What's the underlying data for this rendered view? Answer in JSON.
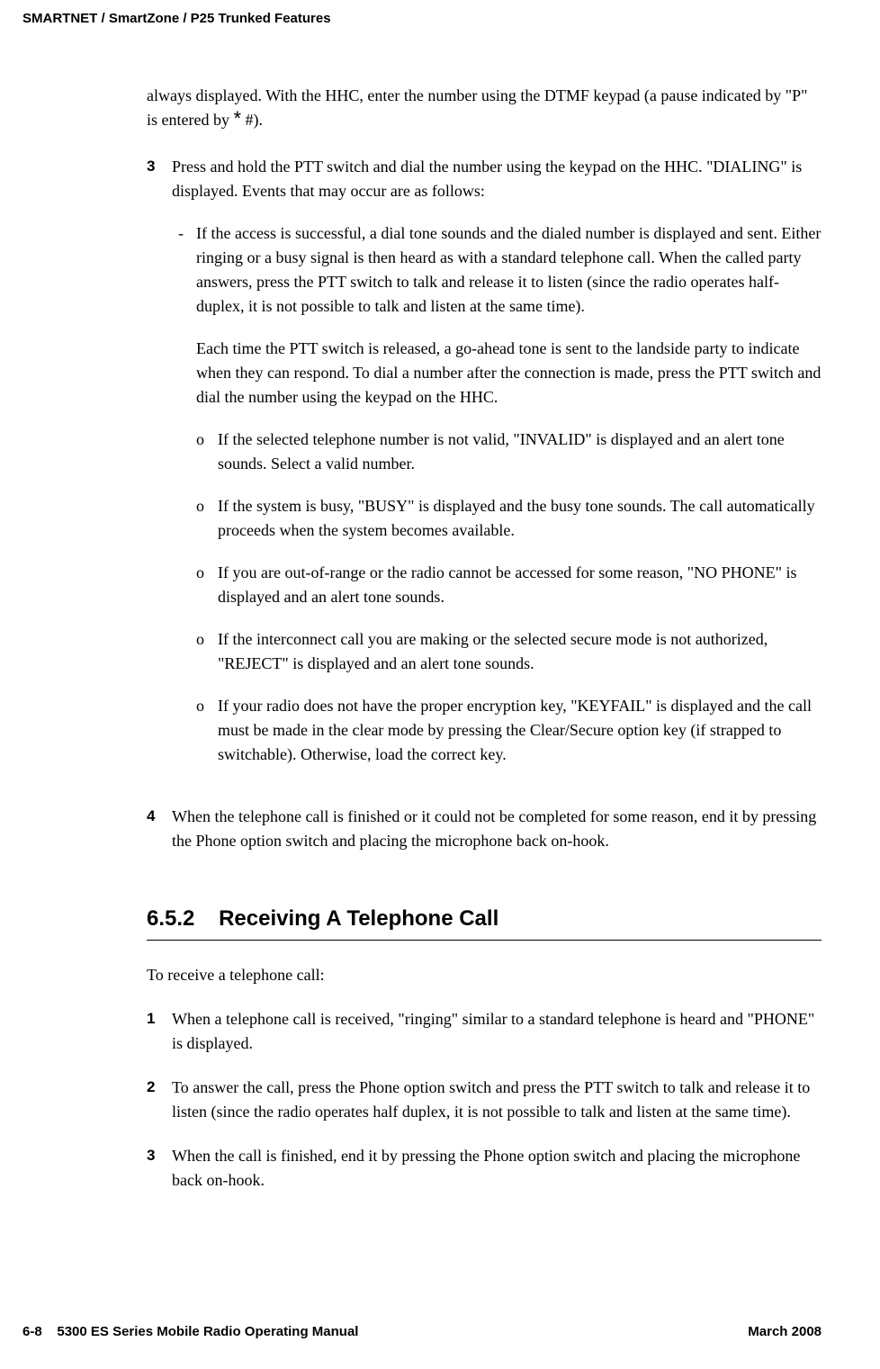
{
  "header": "SMARTNET / SmartZone / P25 Trunked Features",
  "continuation": {
    "text_before_asterisk": "always displayed. With the HHC, enter the number using the DTMF keypad (a pause indicated by \"P\" is entered by ",
    "asterisk": "*",
    "text_after_asterisk": " #)."
  },
  "step3": {
    "num": "3",
    "intro": "Press and hold the PTT switch and dial the number using the keypad on the HHC. \"DIALING\" is displayed. Events that may occur are as follows:",
    "dash": {
      "marker": "-",
      "text": "If the access is successful, a dial tone sounds and the dialed number is displayed and sent. Either ringing or a busy signal is then heard as with a standard telephone call. When the called party answers, press the PTT switch to talk and release it to listen (since the radio operates half-duplex, it is not possible to talk and listen at the same time)."
    },
    "sub_para": "Each time the PTT switch is released, a go-ahead tone is sent to the landside party to indicate when they can respond. To dial a number after the connection is made, press the PTT switch and dial the number using the keypad on the HHC.",
    "circles": [
      "If the selected telephone number is not valid, \"INVALID\" is displayed and an alert tone sounds. Select a valid number.",
      "If the system is busy, \"BUSY\" is displayed and the busy tone sounds. The call automatically proceeds when the system becomes available.",
      "If you are out-of-range or the radio cannot be accessed for some reason, \"NO PHONE\" is displayed and an alert tone sounds.",
      "If the interconnect call you are making or the selected secure mode is not authorized, \"REJECT\" is displayed and an alert tone sounds.",
      "If your radio does not have the proper encryption key, \"KEYFAIL\" is displayed and the call must be made in the clear mode by pressing the Clear/Secure option key (if strapped to switchable). Otherwise, load the correct key."
    ],
    "circle_marker": "o"
  },
  "step4": {
    "num": "4",
    "text": "When the telephone call is finished or it could not be completed for some reason, end it by pressing the Phone option switch and placing the microphone back on-hook."
  },
  "section": {
    "number": "6.5.2",
    "title": "Receiving A Telephone Call",
    "intro": "To receive a telephone call:",
    "steps": [
      {
        "num": "1",
        "text": "When a telephone call is received, \"ringing\" similar to a standard telephone is heard and \"PHONE\" is displayed."
      },
      {
        "num": "2",
        "text": "To answer the call, press the Phone option switch and press the PTT switch to talk and release it to listen (since the radio operates half duplex, it is not possible to talk and listen at the same time)."
      },
      {
        "num": "3",
        "text": "When the call is finished, end it by pressing the Phone option switch and placing the microphone back on-hook."
      }
    ]
  },
  "footer": {
    "left_page": "6-8",
    "left_title": "5300 ES Series Mobile Radio Operating Manual",
    "right": "March 2008"
  }
}
